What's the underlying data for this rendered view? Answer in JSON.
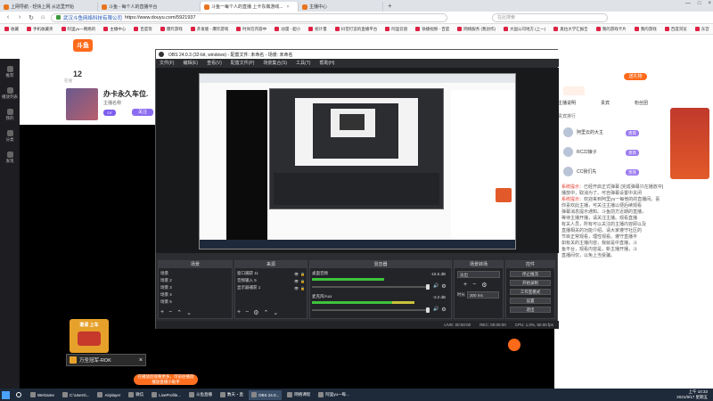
{
  "browser": {
    "tabs": [
      {
        "label": "上网导航 - 轻快上网 从这里开始"
      },
      {
        "label": "斗鱼 - 每个人的直播平台"
      },
      {
        "label": "斗鱼一每个人的直播 上卡东做游戏...",
        "active": true
      },
      {
        "label": "主播中心"
      }
    ],
    "url_prefix": "武汉斗鱼网络科技有限公司",
    "url": "https://www.douyu.com/5921937",
    "search_placeholder": "在此搜索",
    "bookmarks": [
      "收藏",
      "手机收藏夹",
      "阿里yu一网络的",
      "主播中心",
      "百度等",
      "爆炸游戏",
      "开发版 - 爆炸游戏",
      "时尚在内容中",
      "动漫 - 超小",
      "统计量",
      "抖音打造的直播平台",
      "阿里云盘",
      "快播视频 - 百度",
      "网络服务 (我创作)",
      "大国公司地方 (上一)",
      "奥拉大学汇报告",
      "我的游戏卡片",
      "我的游戏",
      "百度浏览",
      "东宫",
      "美丽下载"
    ]
  },
  "douyu": {
    "logo": "斗鱼",
    "left_nav": [
      "推荐",
      "播放列表",
      "我的",
      "分类",
      "发现"
    ],
    "stream": {
      "count": "12",
      "count_label": "在线",
      "title": "办卡永久车位.",
      "streamer": "主播名称",
      "level": "LV",
      "btn": "关注"
    },
    "right": {
      "tabs": [
        "主播说明",
        "贵宾",
        "粉丝团"
      ],
      "rank_title": "贵宾排行",
      "users": [
        {
          "name": "阿里云的大主",
          "badge": "贵宾"
        },
        {
          "name": "RC22娘子",
          "badge": "贵宾"
        },
        {
          "name": "CC我们先",
          "badge": "贵宾"
        }
      ],
      "chat": [
        {
          "pre": "系统提示：",
          "text": "已经开启正式弹幕 [完成弹幕只在播放中]"
        },
        {
          "pre": "",
          "text": "播放中，取消为了。可自弹幕设置中关闭"
        },
        {
          "pre": "系统提示：",
          "text": "欢迎来到阿里yu一每他的的直播间。喜"
        },
        {
          "pre": "",
          "text": "你喜欢此主播，可关注主播以便后续观看"
        },
        {
          "pre": "",
          "text": "弹幕消息提示通知。斗鱼前方近期的直播，"
        },
        {
          "pre": "",
          "text": "等待主播开播，请关注主播。观看直播"
        },
        {
          "pre": "",
          "text": "有关人员，所有可以关注的主播内容即以及"
        },
        {
          "pre": "",
          "text": "直播相关的功能介绍。请大家遵守社区的"
        },
        {
          "pre": "",
          "text": "节目正常观看，理性观看。遵守直播平"
        },
        {
          "pre": "",
          "text": "如有关的主播内容，我就是中直播，斗"
        },
        {
          "pre": "",
          "text": "鱼平台，观看内容是，新主播开播，斗"
        },
        {
          "pre": "",
          "text": "直播间仅，以免上当受骗。"
        }
      ],
      "promo_btn": "送礼物"
    },
    "gift_ad": "邀请 上车",
    "popup_label": "万圣冠军-ROK",
    "popup_close": "×",
    "banner_line1": "在播放后观看更多，可前往播放",
    "banner_line2": "播放直播小助手"
  },
  "obs": {
    "title": "OBS 24.0.3 (32-bit, windows) - 配置文件: 未命名 - 场景: 未命名",
    "menu": [
      "文件(F)",
      "编辑(E)",
      "查看(V)",
      "配置文件(P)",
      "场景集合(S)",
      "工具(T)",
      "帮助(H)"
    ],
    "docks": {
      "scenes": {
        "header": "场景",
        "items": [
          "场景",
          "场景 2",
          "场景 3",
          "场景 4",
          "场景 5"
        ]
      },
      "sources": {
        "header": "来源",
        "items": [
          "窗口捕获 11",
          "音频输入 5",
          "显示器捕获 1"
        ]
      },
      "mixer": {
        "header": "混音器",
        "tracks": [
          {
            "name": "桌面音频",
            "db": "-16.5 dB",
            "level": 0.6
          },
          {
            "name": "麦克风/Aux",
            "db": "-3.2 dB",
            "level": 0.85
          }
        ]
      },
      "transitions": {
        "header": "场景转场",
        "mode": "淡出",
        "duration_label": "时长",
        "duration": "300 ms"
      },
      "controls": {
        "header": "控件",
        "buttons": [
          "停止推流",
          "开始录制",
          "工作室模式",
          "设置",
          "退出"
        ]
      }
    },
    "status": {
      "live": "LIVE: 00:00:00",
      "rec": "REC: 00:00:00",
      "cpu": "CPU: 1.0%, 60.00 fps"
    }
  },
  "taskbar": {
    "items": [
      "WeGame",
      "C:\\Users\\...",
      "Airplayer",
      "微信",
      "LiveProfile...",
      "斗鱼直播",
      "数天・直",
      "OBS 24.0...",
      "网络课程",
      "阿里yu一每..."
    ],
    "time": "上午 10:33",
    "date": "2021/9/17 星期五"
  },
  "colors": {
    "douyu_orange": "#ff6a1a",
    "obs_bg": "#2b2d31",
    "taskbar": "#1e2a3a"
  }
}
